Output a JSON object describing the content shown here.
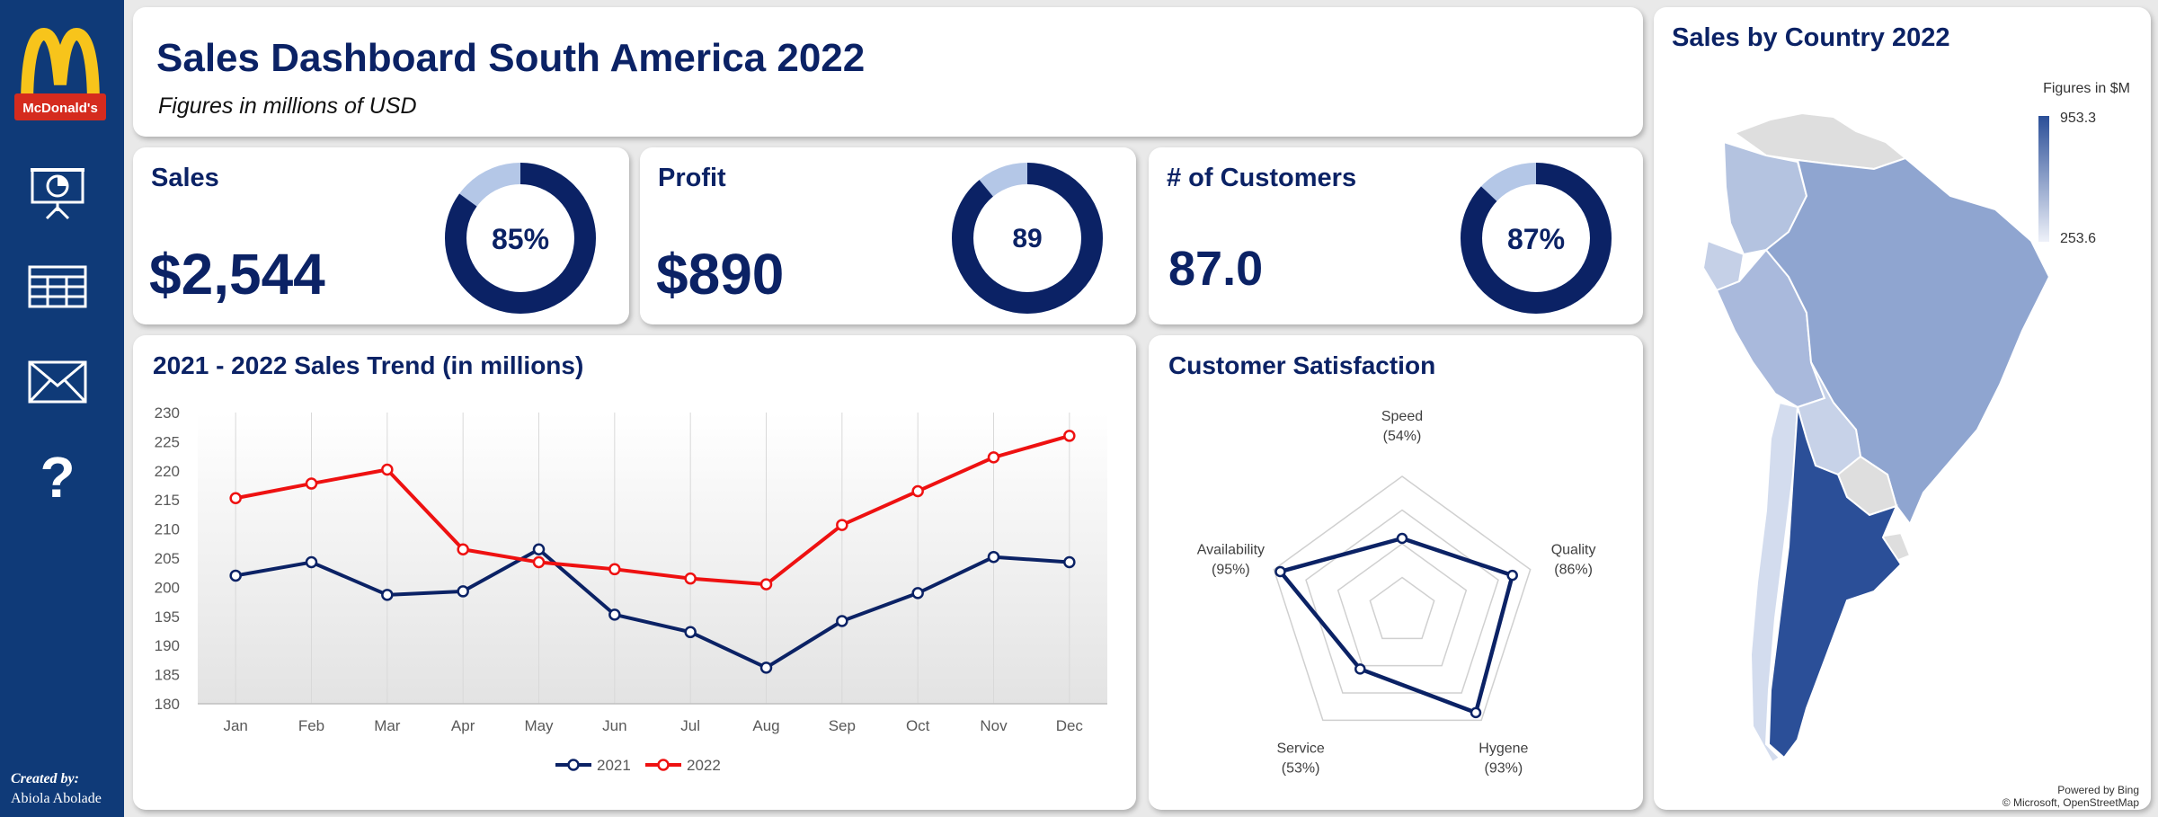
{
  "brand": {
    "logo_text": "McDonald's"
  },
  "sidebar": {
    "items": [
      {
        "name": "presentation-icon"
      },
      {
        "name": "table-icon"
      },
      {
        "name": "mail-icon"
      },
      {
        "name": "help-icon",
        "glyph": "?"
      }
    ],
    "credit_label": "Created by:",
    "credit_name": "Abiola Abolade"
  },
  "header": {
    "title": "Sales Dashboard South America 2022",
    "subtitle": "Figures in millions of USD"
  },
  "kpis": [
    {
      "label": "Sales",
      "value": "$2,544",
      "donut_label": "85%",
      "percent": 85
    },
    {
      "label": "Profit",
      "value": "$890",
      "donut_label": "89",
      "percent": 89
    },
    {
      "label": "# of Customers",
      "value": "87.0",
      "donut_label": "87%",
      "percent": 87
    }
  ],
  "colors": {
    "navy": "#0b2265",
    "red": "#ee1111",
    "donut_rest": "#b4c7e7",
    "sidebar": "#0f3a78"
  },
  "chart_data": [
    {
      "type": "line",
      "title": "2021 - 2022 Sales Trend (in millions)",
      "categories": [
        "Jan",
        "Feb",
        "Mar",
        "Apr",
        "May",
        "Jun",
        "Jul",
        "Aug",
        "Sep",
        "Oct",
        "Nov",
        "Dec"
      ],
      "series": [
        {
          "name": "2021",
          "color": "#0b2265",
          "values": [
            202,
            204.3,
            198.7,
            199.3,
            206.5,
            195.3,
            192.3,
            186.2,
            194.2,
            199,
            205.2,
            204.3
          ]
        },
        {
          "name": "2022",
          "color": "#ee1111",
          "values": [
            215.3,
            217.8,
            220.2,
            206.5,
            204.3,
            203.1,
            201.5,
            200.5,
            210.7,
            216.5,
            222.3,
            226
          ]
        }
      ],
      "ylim": [
        180,
        230
      ],
      "yticks": [
        230,
        225,
        220,
        215,
        210,
        205,
        200,
        195,
        190,
        185,
        180
      ],
      "legend": "bottom",
      "grid": "vertical"
    },
    {
      "type": "radar",
      "title": "Customer Satisfaction",
      "axes": [
        {
          "name": "Speed",
          "pct_label": "(54%)",
          "value": 54
        },
        {
          "name": "Quality",
          "pct_label": "(86%)",
          "value": 86
        },
        {
          "name": "Hygene",
          "pct_label": "(93%)",
          "value": 93
        },
        {
          "name": "Service",
          "pct_label": "(53%)",
          "value": 53
        },
        {
          "name": "Availability",
          "pct_label": "(95%)",
          "value": 95
        }
      ],
      "range": [
        0,
        100
      ],
      "rings": 4
    },
    {
      "type": "map",
      "title": "Sales by Country 2022",
      "legend_title": "Figures in $M",
      "legend_max": "953.3",
      "legend_min": "253.6",
      "attribution_1": "Powered by Bing",
      "attribution_2": "© Microsoft, OpenStreetMap"
    }
  ]
}
